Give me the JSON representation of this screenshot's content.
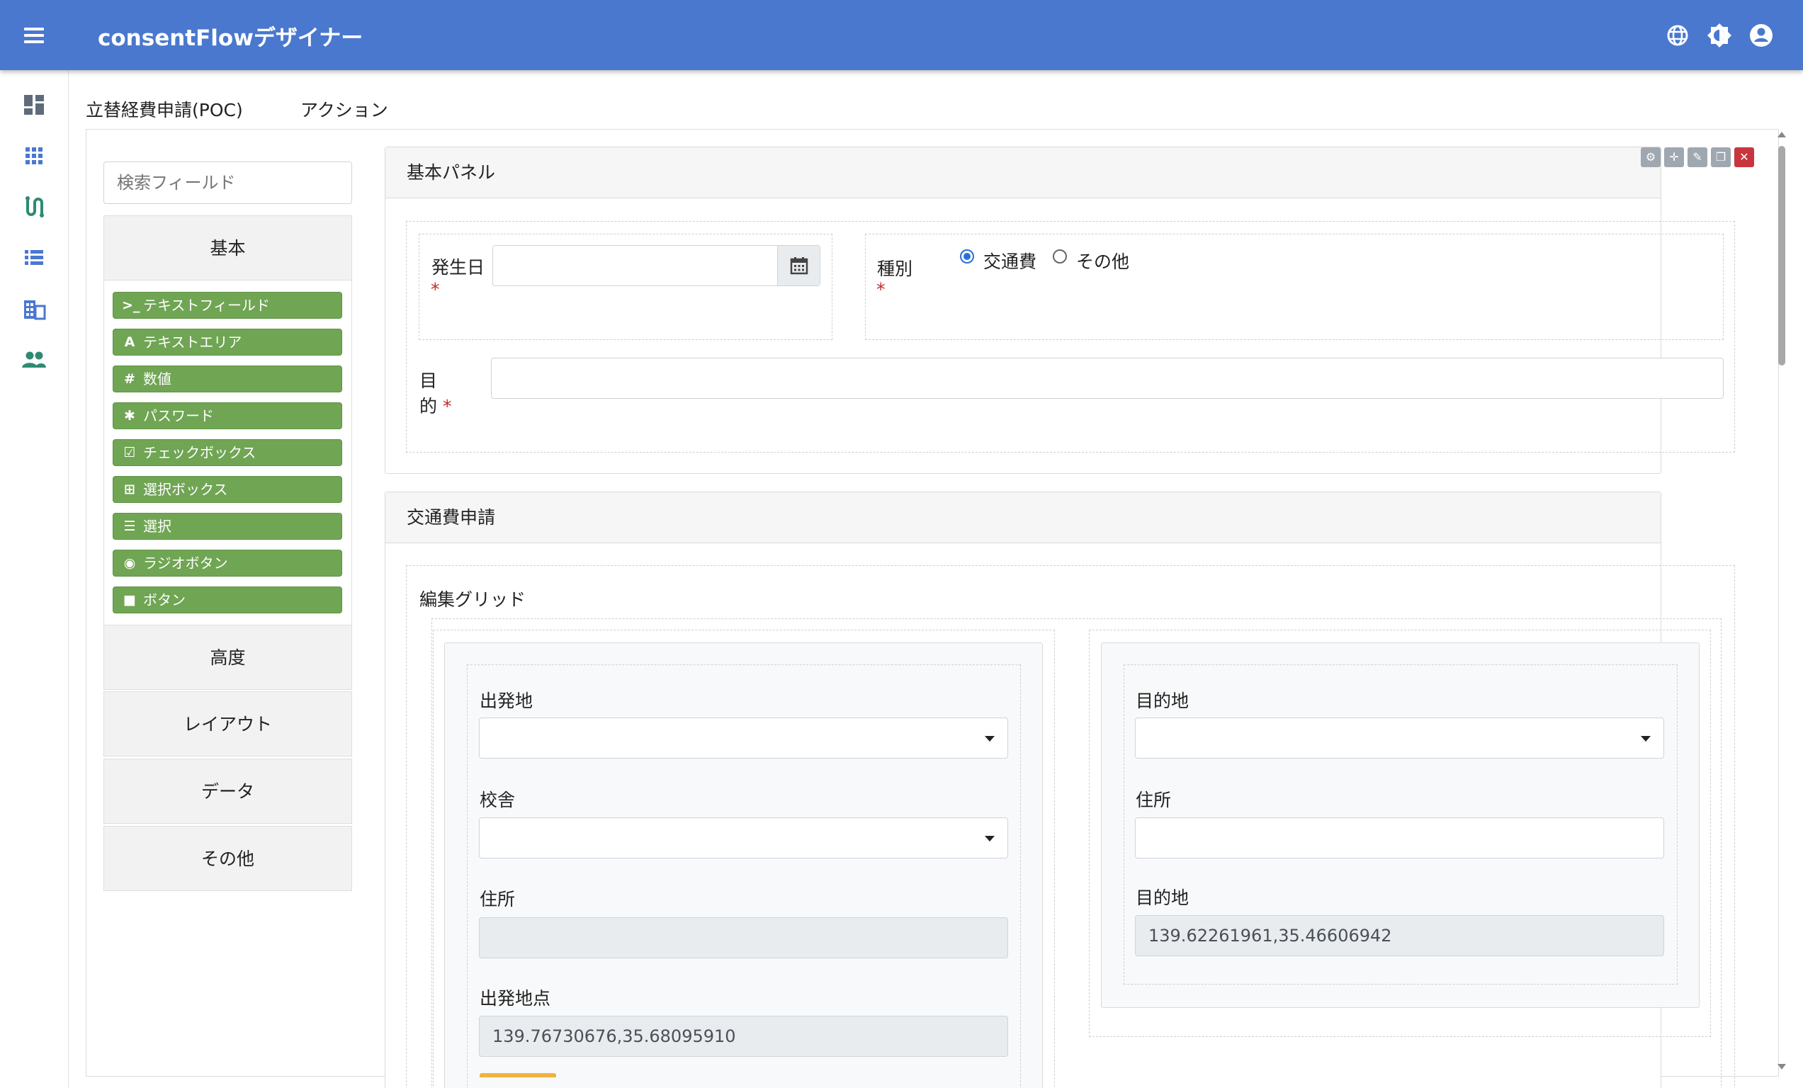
{
  "app": {
    "title": "consentFlowデザイナー",
    "icons": [
      "menu-icon",
      "globe-icon",
      "theme-toggle-icon",
      "account-circle-icon"
    ],
    "accent": "#4a78cf"
  },
  "nav_rail": {
    "icons": [
      "dashboard-icon",
      "apps-grid-icon",
      "workflow-icon",
      "list-icon",
      "building-icon",
      "users-icon"
    ],
    "accent": "#2f8a73"
  },
  "tabs": [
    {
      "label": "立替経費申請(POC)"
    },
    {
      "label": "アクション"
    }
  ],
  "sidebar": {
    "search_placeholder": "検索フィールド",
    "groups": [
      {
        "label": "基本"
      },
      {
        "label": "高度"
      },
      {
        "label": "レイアウト"
      },
      {
        "label": "データ"
      },
      {
        "label": "その他"
      }
    ],
    "components": [
      {
        "label": "テキストフィールド",
        "icon": "terminal-icon",
        "glyph": ">_"
      },
      {
        "label": "テキストエリア",
        "icon": "font-icon",
        "glyph": "A"
      },
      {
        "label": "数値",
        "icon": "hash-icon",
        "glyph": "#"
      },
      {
        "label": "パスワード",
        "icon": "asterisk-icon",
        "glyph": "✱"
      },
      {
        "label": "チェックボックス",
        "icon": "checkbox-icon",
        "glyph": "☑"
      },
      {
        "label": "選択ボックス",
        "icon": "plus-square-icon",
        "glyph": "⊞"
      },
      {
        "label": "選択",
        "icon": "list-icon",
        "glyph": "☰"
      },
      {
        "label": "ラジオボタン",
        "icon": "dot-circle-icon",
        "glyph": "◉"
      },
      {
        "label": "ボタン",
        "icon": "stop-icon",
        "glyph": "■"
      }
    ],
    "component_color": "#70a554"
  },
  "basic_panel": {
    "title": "基本パネル",
    "tools": [
      "gear-icon",
      "move-icon",
      "wrench-icon",
      "copy-icon",
      "close-icon"
    ],
    "date_label": "発生日",
    "date_value": "",
    "type_label": "種別",
    "type_options": [
      {
        "label": "交通費",
        "selected": true
      },
      {
        "label": "その他",
        "selected": false
      }
    ],
    "purpose_label_1": "目",
    "purpose_label_2": "的",
    "purpose_value": "",
    "required_mark": "*"
  },
  "transport_panel": {
    "title": "交通費申請",
    "grid_title": "編集グリッド",
    "left": {
      "departure_label": "出発地",
      "departure_value": "",
      "campus_label": "校舎",
      "campus_value": "",
      "address_label": "住所",
      "address_value": "",
      "departure_point_label": "出発地点",
      "departure_point_value": "139.76730676,35.68095910"
    },
    "right": {
      "destination_label": "目的地",
      "destination_value": "",
      "address_label": "住所",
      "address_value": "",
      "destination_point_label": "目的地",
      "destination_point_value": "139.62261961,35.46606942"
    }
  }
}
